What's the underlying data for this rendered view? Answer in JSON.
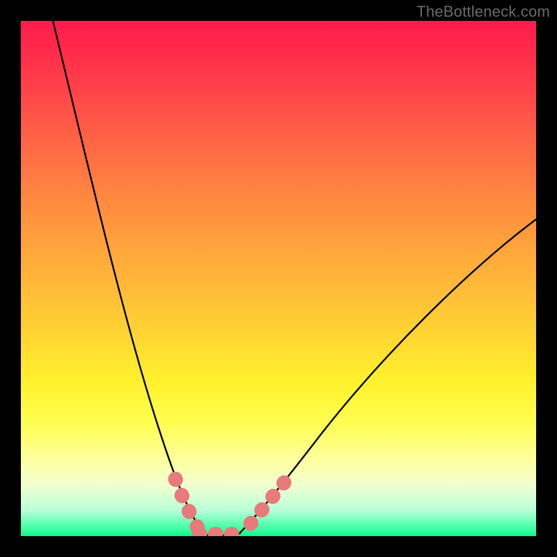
{
  "watermark": {
    "text": "TheBottleneck.com"
  },
  "colors": {
    "background": "#000000",
    "gradient_top": "#ff1a4d",
    "gradient_bottom": "#10f58a",
    "curve": "#000000",
    "highlight": "#e77a7a"
  },
  "chart_data": {
    "type": "line",
    "title": "",
    "xlabel": "",
    "ylabel": "",
    "xlim": [
      0,
      100
    ],
    "ylim": [
      0,
      100
    ],
    "grid": false,
    "legend": false,
    "description": "Bottleneck-style V-curve: steep left descent, flat minimum near zero around x≈34–42, gentler right ascent; pink highlight segments on both sides of the minimum and across the floor.",
    "series": [
      {
        "name": "left-descent",
        "x": [
          6,
          10,
          14,
          18,
          22,
          26,
          30,
          34
        ],
        "y": [
          100,
          84,
          68,
          52,
          37,
          23,
          10,
          1
        ]
      },
      {
        "name": "floor",
        "x": [
          34,
          36,
          38,
          40,
          42
        ],
        "y": [
          1,
          0.5,
          0.3,
          0.5,
          1
        ]
      },
      {
        "name": "right-ascent",
        "x": [
          42,
          50,
          58,
          66,
          74,
          82,
          90,
          100
        ],
        "y": [
          1,
          8,
          16,
          24,
          32,
          40,
          48,
          58
        ]
      }
    ],
    "highlights": [
      {
        "x": [
          30,
          31,
          32,
          33,
          34
        ],
        "y": [
          10,
          7,
          5,
          3,
          1
        ]
      },
      {
        "x": [
          34,
          36,
          38,
          40,
          42
        ],
        "y": [
          1,
          0.5,
          0.3,
          0.5,
          1
        ]
      },
      {
        "x": [
          45,
          46,
          47,
          48,
          49,
          50
        ],
        "y": [
          3,
          4,
          5,
          6,
          7,
          8
        ]
      }
    ]
  }
}
